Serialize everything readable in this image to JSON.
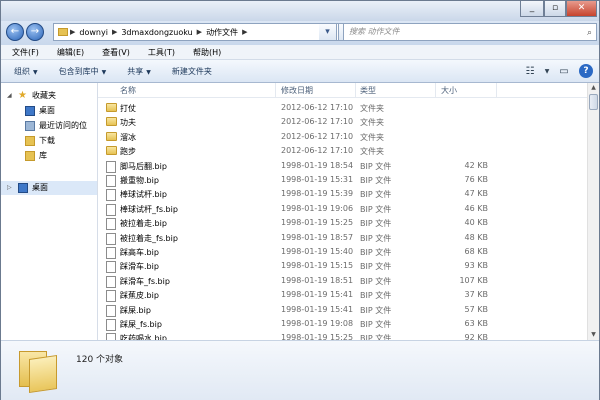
{
  "address": {
    "segments": [
      "downyi",
      "3dmaxdongzuoku",
      "动作文件"
    ],
    "search_placeholder": "搜索 动作文件"
  },
  "menu": [
    "文件(F)",
    "编辑(E)",
    "查看(V)",
    "工具(T)",
    "帮助(H)"
  ],
  "toolbar": {
    "organize": "组织",
    "include": "包含到库中",
    "share": "共享",
    "new_folder": "新建文件夹"
  },
  "nav": {
    "favorites": "收藏夹",
    "desktop": "桌面",
    "recent": "最近访问的位",
    "downloads": "下载",
    "library": "库",
    "desktop_root": "桌面"
  },
  "columns": {
    "name": "名称",
    "date": "修改日期",
    "type": "类型",
    "size": "大小"
  },
  "files": [
    {
      "name": "打仗",
      "date": "2012-06-12 17:10",
      "type": "文件夹",
      "size": "",
      "kind": "folder"
    },
    {
      "name": "功夫",
      "date": "2012-06-12 17:10",
      "type": "文件夹",
      "size": "",
      "kind": "folder"
    },
    {
      "name": "溜冰",
      "date": "2012-06-12 17:10",
      "type": "文件夹",
      "size": "",
      "kind": "folder"
    },
    {
      "name": "跑步",
      "date": "2012-06-12 17:10",
      "type": "文件夹",
      "size": "",
      "kind": "folder"
    },
    {
      "name": "脚马后翻.bip",
      "date": "1998-01-19 18:54",
      "type": "BIP 文件",
      "size": "42 KB",
      "kind": "file"
    },
    {
      "name": "搬重物.bip",
      "date": "1998-01-19 15:31",
      "type": "BIP 文件",
      "size": "76 KB",
      "kind": "file"
    },
    {
      "name": "棒球试杆.bip",
      "date": "1998-01-19 15:39",
      "type": "BIP 文件",
      "size": "47 KB",
      "kind": "file"
    },
    {
      "name": "棒球试杆_fs.bip",
      "date": "1998-01-19 19:06",
      "type": "BIP 文件",
      "size": "46 KB",
      "kind": "file"
    },
    {
      "name": "被拉着走.bip",
      "date": "1998-01-19 15:25",
      "type": "BIP 文件",
      "size": "40 KB",
      "kind": "file"
    },
    {
      "name": "被拉着走_fs.bip",
      "date": "1998-01-19 18:57",
      "type": "BIP 文件",
      "size": "48 KB",
      "kind": "file"
    },
    {
      "name": "踩高车.bip",
      "date": "1998-01-19 15:40",
      "type": "BIP 文件",
      "size": "68 KB",
      "kind": "file"
    },
    {
      "name": "踩滑车.bip",
      "date": "1998-01-19 15:15",
      "type": "BIP 文件",
      "size": "93 KB",
      "kind": "file"
    },
    {
      "name": "踩滑车_fs.bip",
      "date": "1998-01-19 18:51",
      "type": "BIP 文件",
      "size": "107 KB",
      "kind": "file"
    },
    {
      "name": "踩蕉皮.bip",
      "date": "1998-01-19 15:41",
      "type": "BIP 文件",
      "size": "37 KB",
      "kind": "file"
    },
    {
      "name": "踩屎.bip",
      "date": "1998-01-19 15:41",
      "type": "BIP 文件",
      "size": "57 KB",
      "kind": "file"
    },
    {
      "name": "踩屎_fs.bip",
      "date": "1998-01-19 19:08",
      "type": "BIP 文件",
      "size": "63 KB",
      "kind": "file"
    },
    {
      "name": "吃药喝水.bip",
      "date": "1998-01-19 15:25",
      "type": "BIP 文件",
      "size": "92 KB",
      "kind": "file"
    }
  ],
  "status": {
    "count": "120 个对象"
  },
  "colors": {
    "selection": "#dbe8f8",
    "folder": "#e6c253",
    "accent": "#2b69c4"
  }
}
